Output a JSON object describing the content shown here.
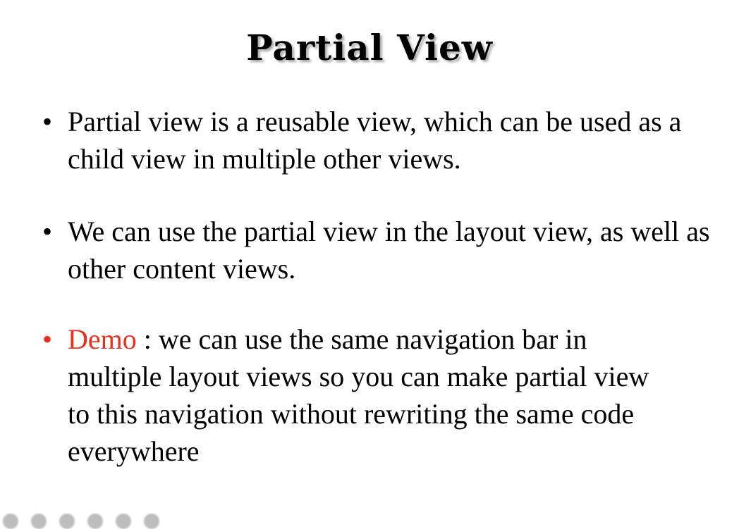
{
  "slide": {
    "title": "Partial View",
    "bullets": [
      {
        "text": "Partial view is a reusable view, which can be used as a child view in multiple other views."
      },
      {
        "text": "We can use the partial view in the layout view, as well as other content views."
      },
      {
        "highlight": "Demo",
        "text": " : we can use the same navigation bar in multiple layout views so you can make partial view to this navigation  without rewriting the same code everywhere"
      }
    ],
    "bullet_symbol": "•",
    "colors": {
      "highlight": "#e8301c",
      "text": "#000000"
    }
  }
}
